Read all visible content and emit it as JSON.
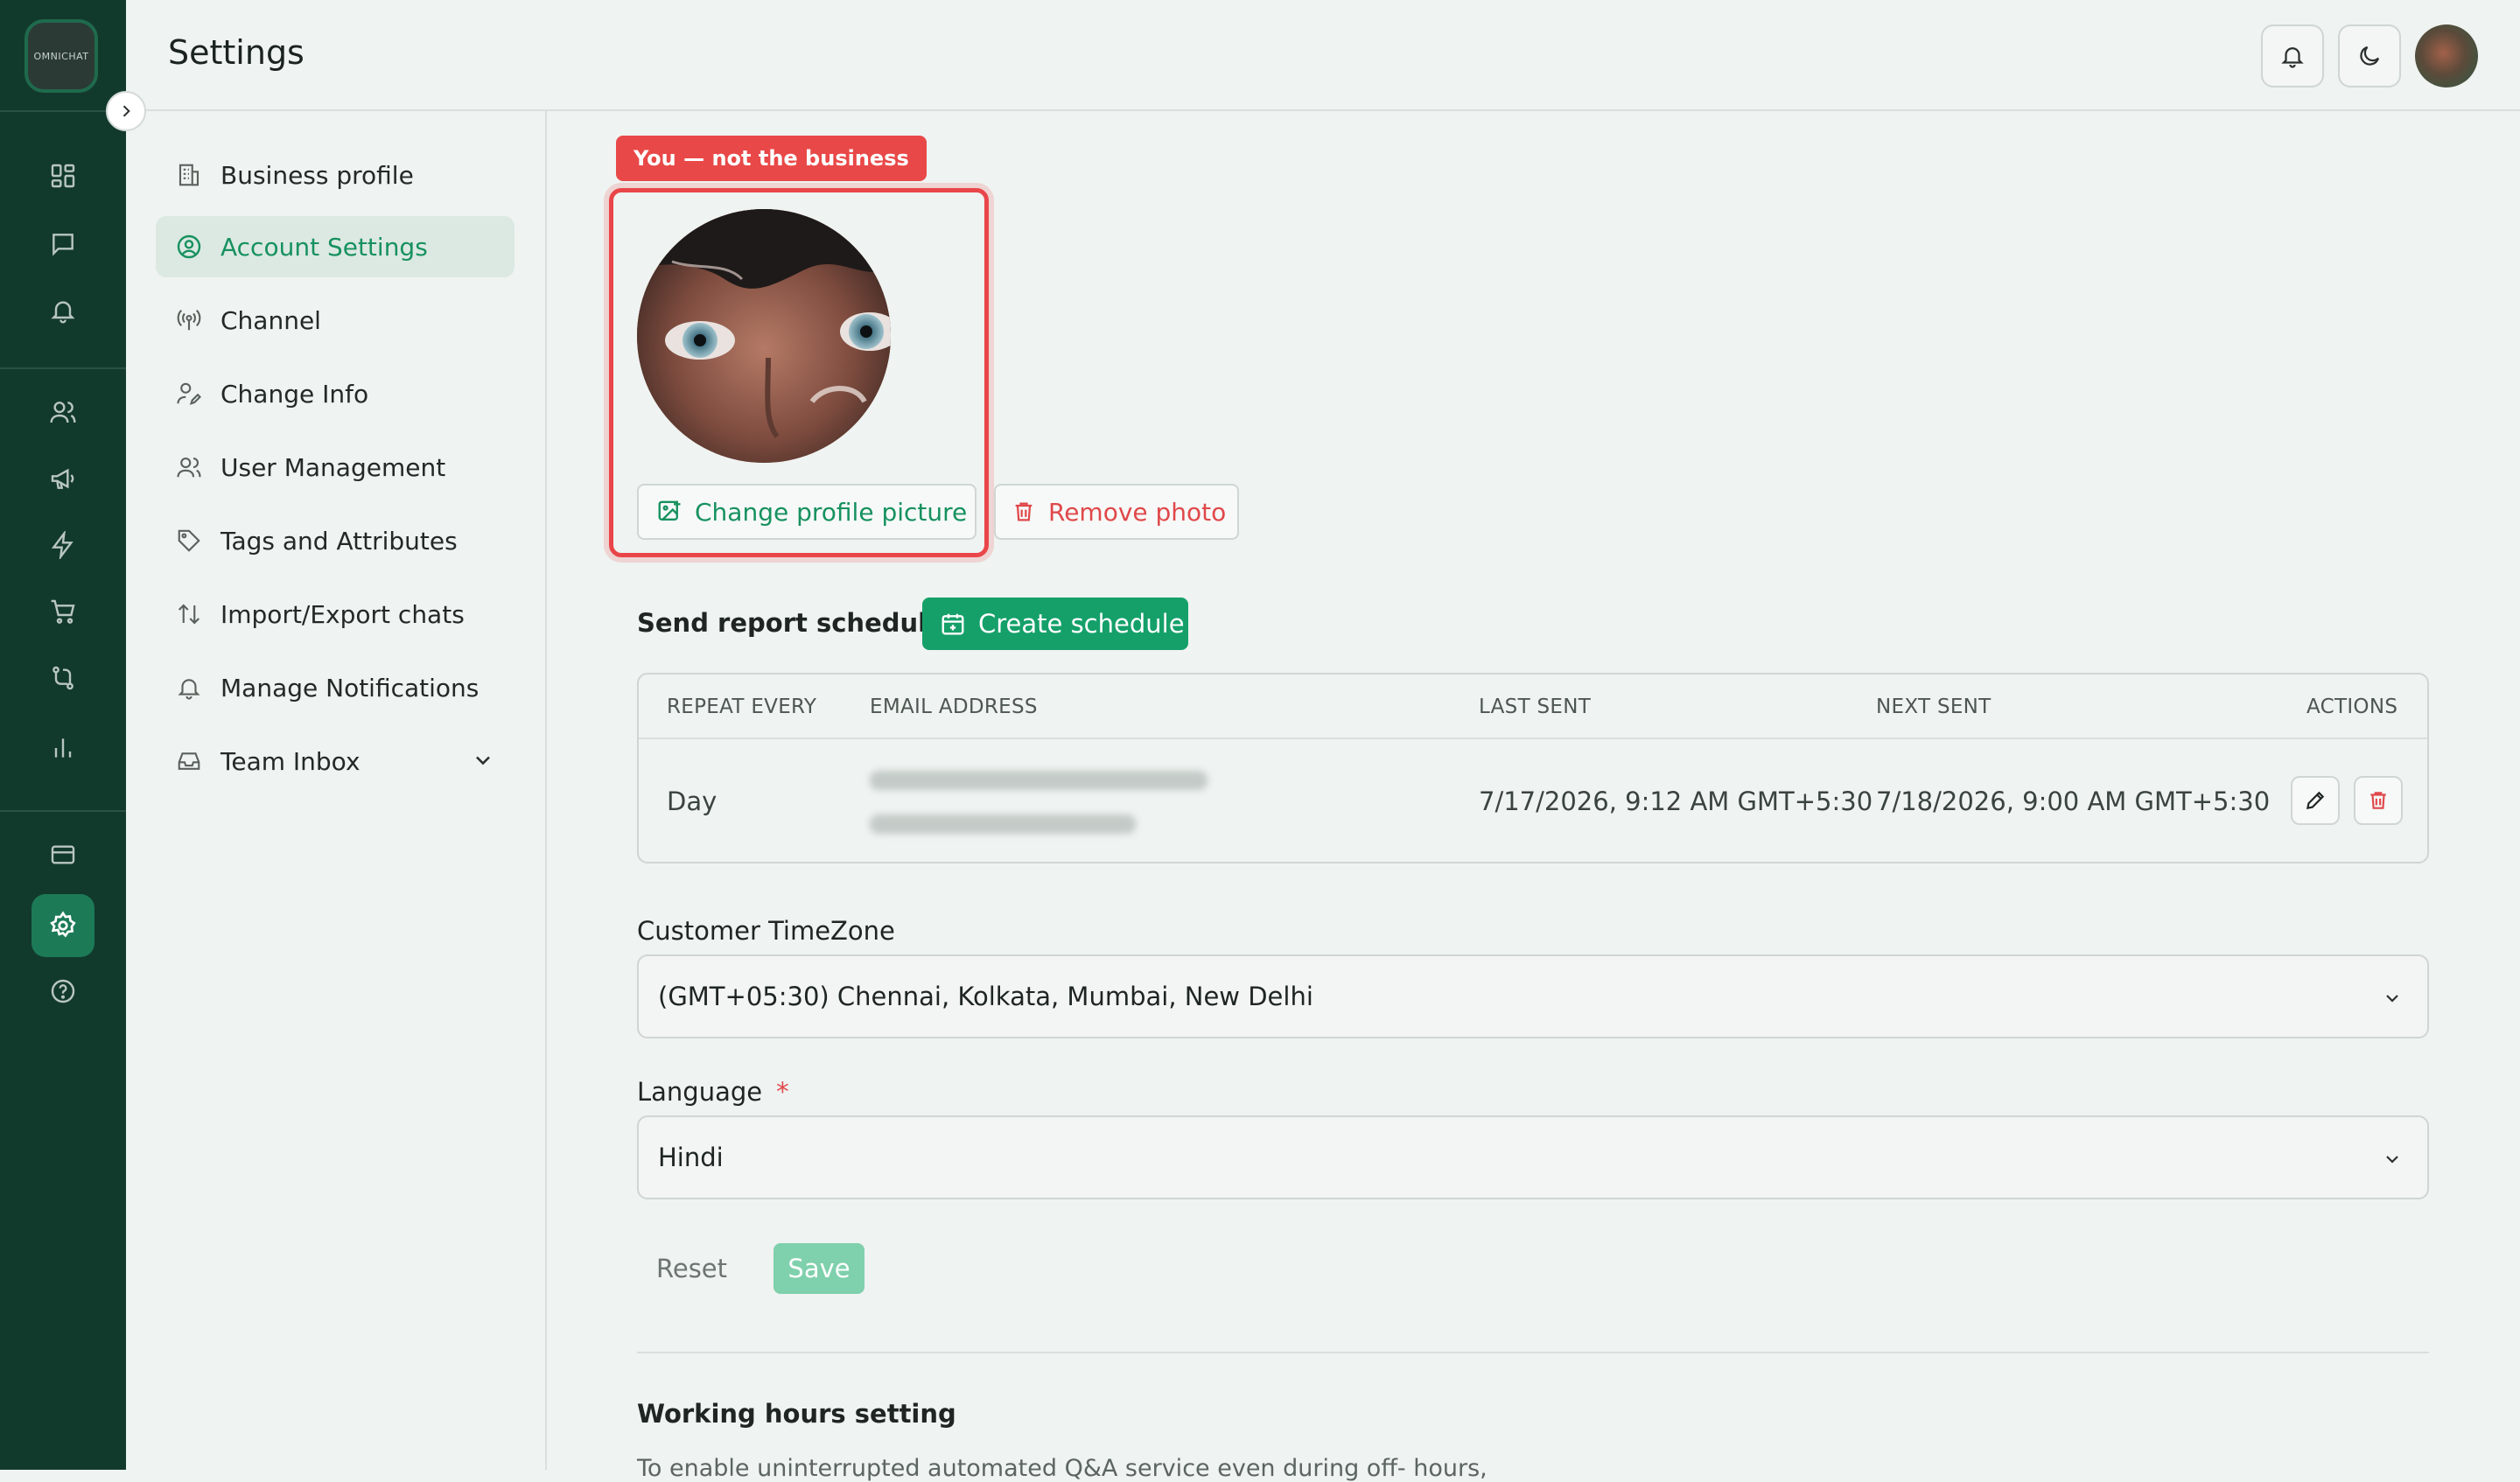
{
  "app": {
    "logo_text": "OMNICHAT"
  },
  "header": {
    "title": "Settings",
    "icons": [
      "bell-icon",
      "moon-icon",
      "user-avatar"
    ]
  },
  "rail": {
    "icons": [
      "dashboard-icon",
      "chat-icon",
      "bell-icon",
      "users-icon",
      "megaphone-icon",
      "lightning-icon",
      "cart-icon",
      "flow-icon",
      "bar-chart-icon",
      "card-icon",
      "gear-icon",
      "help-icon"
    ],
    "active": "gear-icon"
  },
  "subnav": {
    "items": [
      {
        "label": "Business profile",
        "icon": "building-icon"
      },
      {
        "label": "Account Settings",
        "icon": "user-circle-icon",
        "active": true
      },
      {
        "label": "Channel",
        "icon": "broadcast-icon"
      },
      {
        "label": "Change Info",
        "icon": "user-edit-icon"
      },
      {
        "label": "User Management",
        "icon": "users-icon"
      },
      {
        "label": "Tags and Attributes",
        "icon": "tag-icon"
      },
      {
        "label": "Import/Export chats",
        "icon": "arrows-updown-icon"
      },
      {
        "label": "Manage Notifications",
        "icon": "bell-icon"
      },
      {
        "label": "Team Inbox",
        "icon": "inbox-icon"
      }
    ]
  },
  "profile": {
    "tag": "You — not the business",
    "change_label": "Change profile picture",
    "remove_label": "Remove photo"
  },
  "schedule": {
    "label": "Send report schedule:",
    "create_label": "Create schedule",
    "columns": [
      "REPEAT EVERY",
      "EMAIL ADDRESS",
      "LAST SENT",
      "NEXT SENT",
      "ACTIONS"
    ],
    "rows": [
      {
        "repeat": "Day",
        "last_sent": "7/17/2026, 9:12 AM GMT+5:30",
        "next_sent": "7/18/2026, 9:00 AM GMT+5:30"
      }
    ]
  },
  "timezone": {
    "label": "Customer TimeZone",
    "value": "(GMT+05:30) Chennai, Kolkata, Mumbai, New Delhi"
  },
  "language": {
    "label": "Language",
    "required_mark": "*",
    "value": "Hindi"
  },
  "actions": {
    "reset": "Reset",
    "save": "Save"
  },
  "working_hours": {
    "title": "Working hours setting",
    "desc": "To enable uninterrupted automated Q&A service even during off- hours,"
  },
  "colors": {
    "rail": "#123a2c",
    "accent": "#15a06a",
    "danger": "#e94848"
  }
}
